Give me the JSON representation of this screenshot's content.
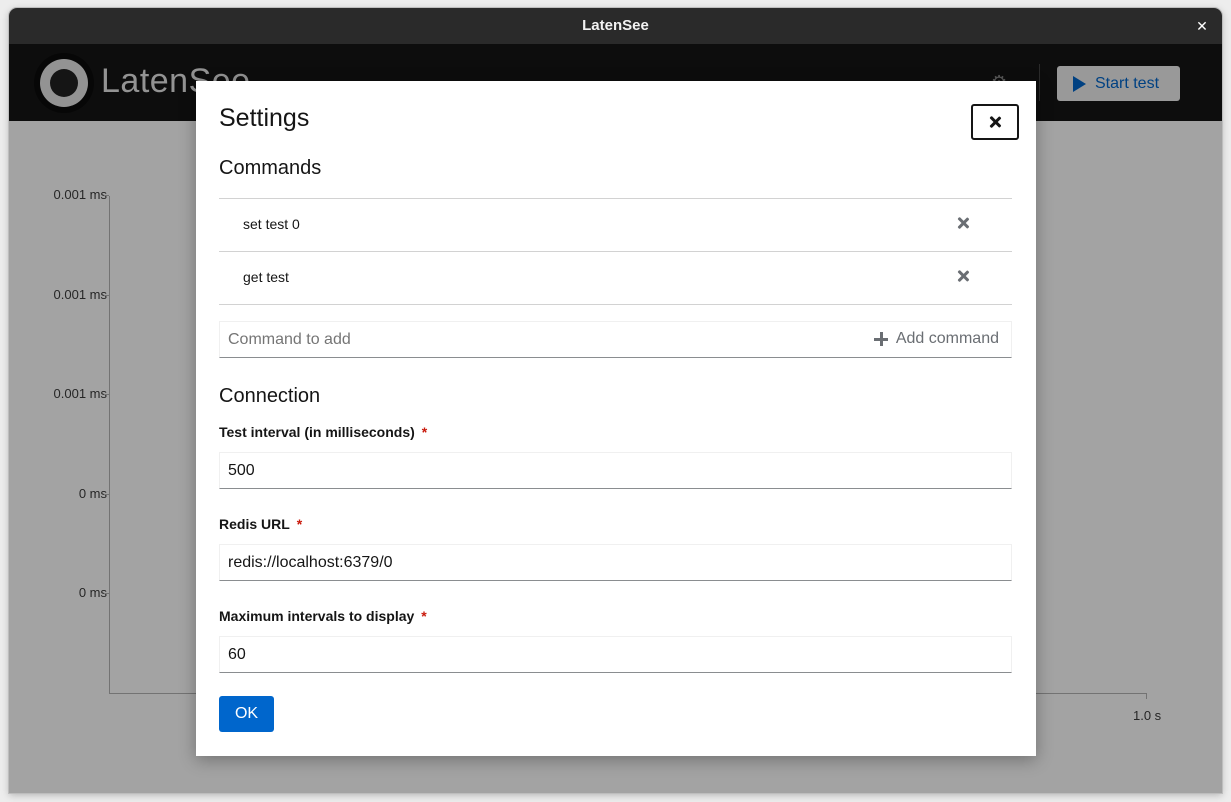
{
  "window": {
    "title": "LatenSee"
  },
  "header": {
    "app_name": "LatenSee",
    "start_label": "Start test"
  },
  "chart_data": {
    "type": "line",
    "y_ticks": [
      "0.001 ms",
      "0.001 ms",
      "0.001 ms",
      "0 ms",
      "0 ms"
    ],
    "x_ticks": [
      "1.0 s"
    ],
    "series": []
  },
  "settings": {
    "title": "Settings",
    "commands_heading": "Commands",
    "commands": [
      {
        "label": "set test 0"
      },
      {
        "label": "get test"
      }
    ],
    "add_placeholder": "Command to add",
    "add_button": "Add command",
    "connection_heading": "Connection",
    "fields": [
      {
        "label": "Test interval (in milliseconds)",
        "value": "500",
        "required": "*"
      },
      {
        "label": "Redis URL",
        "value": "redis://localhost:6379/0",
        "required": "*"
      },
      {
        "label": "Maximum intervals to display",
        "value": "60",
        "required": "*"
      }
    ],
    "ok_label": "OK"
  },
  "colors": {
    "primary": "#0066cc",
    "required": "#c9190b",
    "header_bg": "#151515"
  }
}
